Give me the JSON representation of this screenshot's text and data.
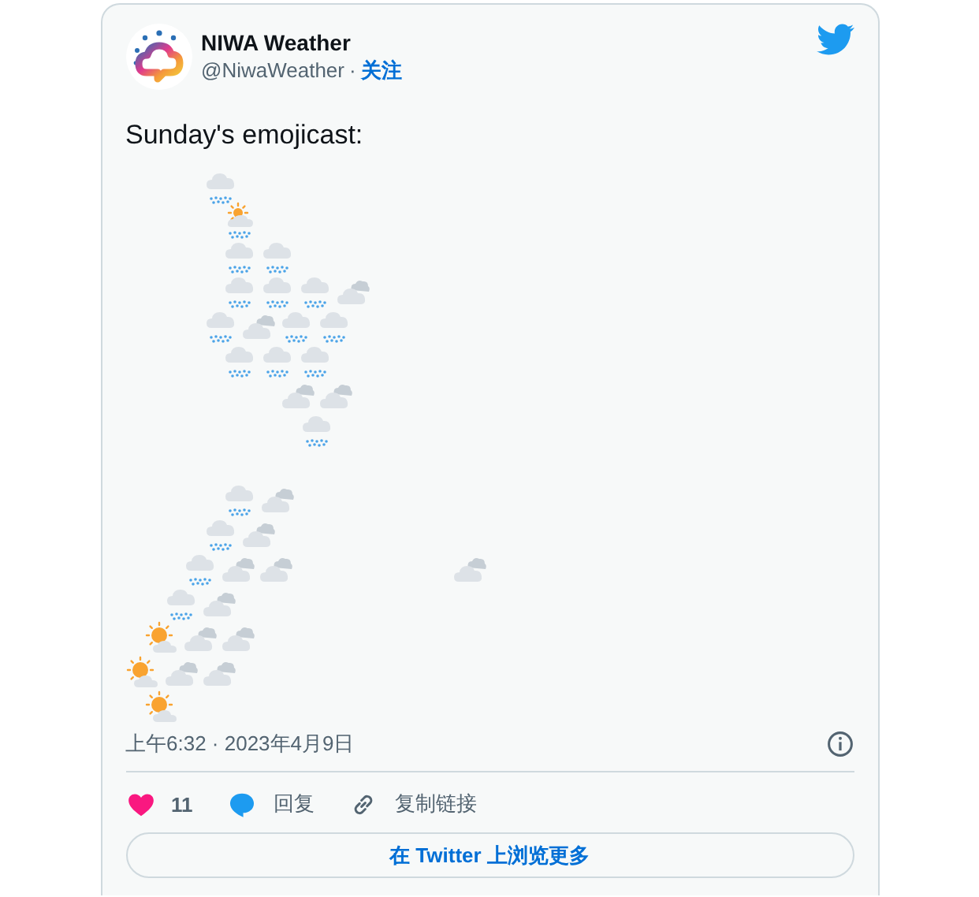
{
  "author": {
    "name": "NIWA Weather",
    "handle": "@NiwaWeather",
    "separator": "·",
    "follow": "关注"
  },
  "text": "Sunday's emojicast:",
  "emojicast": [
    {
      "cells": [
        {
          "kind": "blank"
        },
        {
          "kind": "blank"
        },
        {
          "kind": "blank"
        },
        {
          "kind": "blank"
        },
        {
          "kind": "rain"
        }
      ]
    },
    {
      "cells": [
        {
          "kind": "blank"
        },
        {
          "kind": "blank"
        },
        {
          "kind": "blank"
        },
        {
          "kind": "blank"
        },
        {
          "kind": "blank"
        },
        {
          "kind": "sun_rain"
        }
      ]
    },
    {
      "cells": [
        {
          "kind": "blank"
        },
        {
          "kind": "blank"
        },
        {
          "kind": "blank"
        },
        {
          "kind": "blank"
        },
        {
          "kind": "blank"
        },
        {
          "kind": "rain"
        },
        {
          "kind": "rain"
        }
      ]
    },
    {
      "cells": [
        {
          "kind": "blank"
        },
        {
          "kind": "blank"
        },
        {
          "kind": "blank"
        },
        {
          "kind": "blank"
        },
        {
          "kind": "blank"
        },
        {
          "kind": "rain"
        },
        {
          "kind": "rain"
        },
        {
          "kind": "rain"
        },
        {
          "kind": "cloud"
        }
      ]
    },
    {
      "cells": [
        {
          "kind": "blank"
        },
        {
          "kind": "blank"
        },
        {
          "kind": "blank"
        },
        {
          "kind": "blank"
        },
        {
          "kind": "rain"
        },
        {
          "kind": "cloud"
        },
        {
          "kind": "rain"
        },
        {
          "kind": "rain"
        }
      ]
    },
    {
      "cells": [
        {
          "kind": "blank"
        },
        {
          "kind": "blank"
        },
        {
          "kind": "blank"
        },
        {
          "kind": "blank"
        },
        {
          "kind": "blank"
        },
        {
          "kind": "rain"
        },
        {
          "kind": "rain"
        },
        {
          "kind": "rain"
        }
      ]
    },
    {
      "cells": [
        {
          "kind": "blank"
        },
        {
          "kind": "blank"
        },
        {
          "kind": "blank"
        },
        {
          "kind": "blank"
        },
        {
          "kind": "blank"
        },
        {
          "kind": "blank"
        },
        {
          "kind": "blank"
        },
        {
          "kind": "blank"
        },
        {
          "kind": "cloud"
        },
        {
          "kind": "cloud"
        }
      ]
    },
    {
      "cells": [
        {
          "kind": "blank"
        },
        {
          "kind": "blank"
        },
        {
          "kind": "blank"
        },
        {
          "kind": "blank"
        },
        {
          "kind": "blank"
        },
        {
          "kind": "blank"
        },
        {
          "kind": "blank"
        },
        {
          "kind": "blank"
        },
        {
          "kind": "blank"
        },
        {
          "kind": "rain"
        }
      ]
    },
    {
      "cells": [
        {
          "kind": "blank"
        }
      ]
    },
    {
      "cells": [
        {
          "kind": "blank"
        },
        {
          "kind": "blank"
        },
        {
          "kind": "blank"
        },
        {
          "kind": "blank"
        },
        {
          "kind": "blank"
        },
        {
          "kind": "rain"
        },
        {
          "kind": "cloud"
        }
      ]
    },
    {
      "cells": [
        {
          "kind": "blank"
        },
        {
          "kind": "blank"
        },
        {
          "kind": "blank"
        },
        {
          "kind": "blank"
        },
        {
          "kind": "rain"
        },
        {
          "kind": "cloud"
        }
      ]
    },
    {
      "cells": [
        {
          "kind": "blank"
        },
        {
          "kind": "blank"
        },
        {
          "kind": "blank"
        },
        {
          "kind": "rain"
        },
        {
          "kind": "cloud"
        },
        {
          "kind": "cloud"
        },
        {
          "kind": "blank"
        },
        {
          "kind": "blank"
        },
        {
          "kind": "blank"
        },
        {
          "kind": "blank"
        },
        {
          "kind": "blank"
        },
        {
          "kind": "blank"
        },
        {
          "kind": "blank"
        },
        {
          "kind": "blank"
        },
        {
          "kind": "cloud"
        }
      ]
    },
    {
      "cells": [
        {
          "kind": "blank"
        },
        {
          "kind": "blank"
        },
        {
          "kind": "rain"
        },
        {
          "kind": "cloud"
        }
      ]
    },
    {
      "cells": [
        {
          "kind": "blank"
        },
        {
          "kind": "sun_cloud"
        },
        {
          "kind": "cloud"
        },
        {
          "kind": "cloud"
        }
      ]
    },
    {
      "cells": [
        {
          "kind": "sun_cloud"
        },
        {
          "kind": "cloud"
        },
        {
          "kind": "cloud"
        }
      ]
    },
    {
      "cells": [
        {
          "kind": "blank"
        },
        {
          "kind": "sun_cloud"
        }
      ]
    }
  ],
  "timestamp": "上午6:32 · 2023年4月9日",
  "actions": [
    {
      "kind": "like",
      "label": "11"
    },
    {
      "kind": "reply",
      "label": "回复"
    },
    {
      "kind": "copy_link",
      "label": "复制链接"
    }
  ],
  "more_button": "在 Twitter 上浏览更多"
}
